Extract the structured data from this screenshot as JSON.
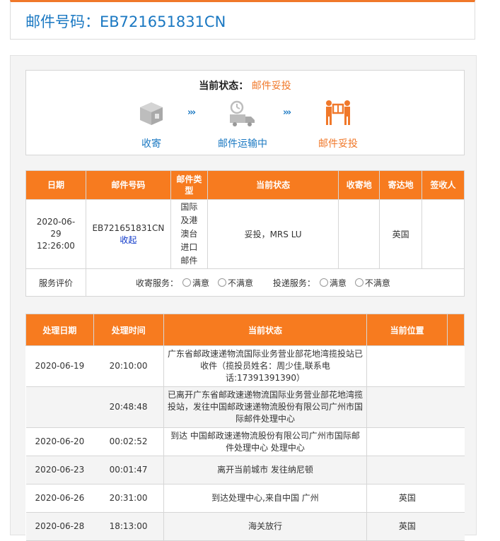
{
  "header": {
    "title": "邮件号码：EB721651831CN"
  },
  "status": {
    "label": "当前状态：",
    "value": "邮件妥投",
    "steps": [
      {
        "icon": "package-box-icon",
        "label": "收寄"
      },
      {
        "icon": "delivery-truck-icon",
        "label": "邮件运输中"
      },
      {
        "icon": "delivered-person-icon",
        "label": "邮件妥投"
      }
    ],
    "arrow": "›››"
  },
  "summary_table": {
    "headers": [
      "日期",
      "邮件号码",
      "邮件类型",
      "当前状态",
      "收寄地",
      "寄达地",
      "签收人"
    ],
    "row": {
      "date": "2020-06-29 12:26:00",
      "number": "EB721651831CN",
      "collapse_link": "收起",
      "type": "国际及港澳台进口邮件",
      "status": "妥投，MRS LU",
      "origin": "",
      "destination": "英国",
      "signer": ""
    },
    "evaluation": {
      "label": "服务评价",
      "collect_label": "收寄服务：",
      "deliver_label": "投递服务：",
      "satisfied": "满意",
      "unsatisfied": "不满意"
    }
  },
  "detail_table": {
    "headers": [
      "处理日期",
      "处理时间",
      "当前状态",
      "当前位置"
    ],
    "rows": [
      {
        "date": "2020-06-19",
        "time": "20:10:00",
        "status": "广东省邮政速递物流国际业务营业部花地湾揽投站已收件（揽投员姓名：周少佳,联系电话:17391391390）",
        "location": ""
      },
      {
        "date": "",
        "time": "20:48:48",
        "status": "已离开广东省邮政速递物流国际业务营业部花地湾揽投站，发往中国邮政速递物流股份有限公司广州市国际邮件处理中心",
        "location": ""
      },
      {
        "date": "2020-06-20",
        "time": "00:02:52",
        "status": "到达 中国邮政速递物流股份有限公司广州市国际邮件处理中心 处理中心",
        "location": ""
      },
      {
        "date": "2020-06-23",
        "time": "00:01:47",
        "status": "离开当前城市 发往纳尼顿",
        "location": ""
      },
      {
        "date": "2020-06-26",
        "time": "20:31:00",
        "status": "到达处理中心,来自中国 广州",
        "location": "英国"
      },
      {
        "date": "2020-06-28",
        "time": "18:13:00",
        "status": "海关放行",
        "location": "英国"
      }
    ]
  },
  "colors": {
    "accent": "#f77b1f",
    "link": "#1a78c2"
  }
}
